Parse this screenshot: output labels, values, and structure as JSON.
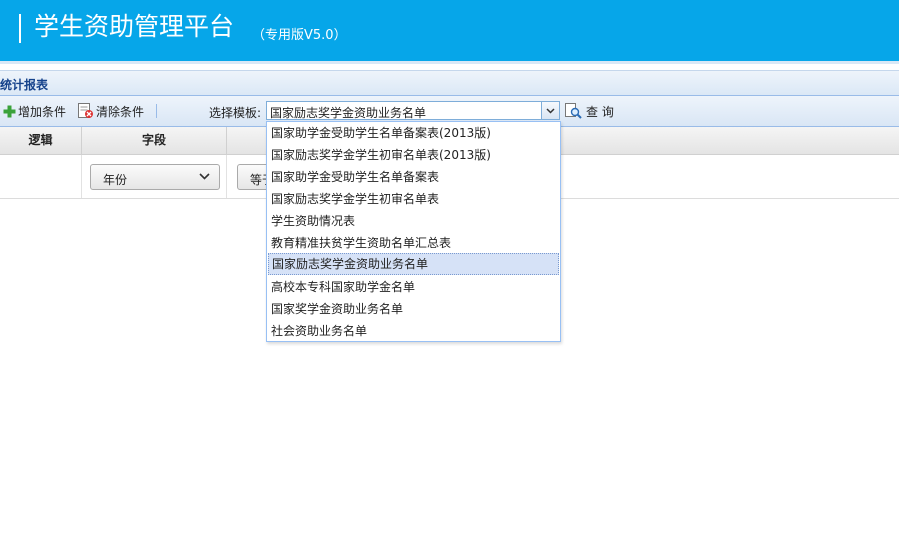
{
  "header": {
    "title": "学生资助管理平台",
    "version": "（专用版V5.0）"
  },
  "panel": {
    "title": "统计报表"
  },
  "toolbar": {
    "add_label": "增加条件",
    "clear_label": "清除条件",
    "template_label": "选择模板:",
    "template_value": "国家励志奖学金资助业务名单",
    "query_label": "查 询"
  },
  "grid": {
    "columns": [
      "逻辑",
      "字段"
    ],
    "row": {
      "field_value": "年份",
      "op_value": "等于"
    }
  },
  "dropdown": {
    "options": [
      "国家助学金受助学生名单备案表(2013版)",
      "国家励志奖学金学生初审名单表(2013版)",
      "国家助学金受助学生名单备案表",
      "国家励志奖学金学生初审名单表",
      "学生资助情况表",
      "教育精准扶贫学生资助名单汇总表",
      "国家励志奖学金资助业务名单",
      "高校本专科国家助学金名单",
      "国家奖学金资助业务名单",
      "社会资助业务名单"
    ],
    "selected_index": 6
  },
  "colors": {
    "header_bg": "#06a6e9",
    "panel_title": "#15428b",
    "selected_bg": "#d6e2f7"
  }
}
